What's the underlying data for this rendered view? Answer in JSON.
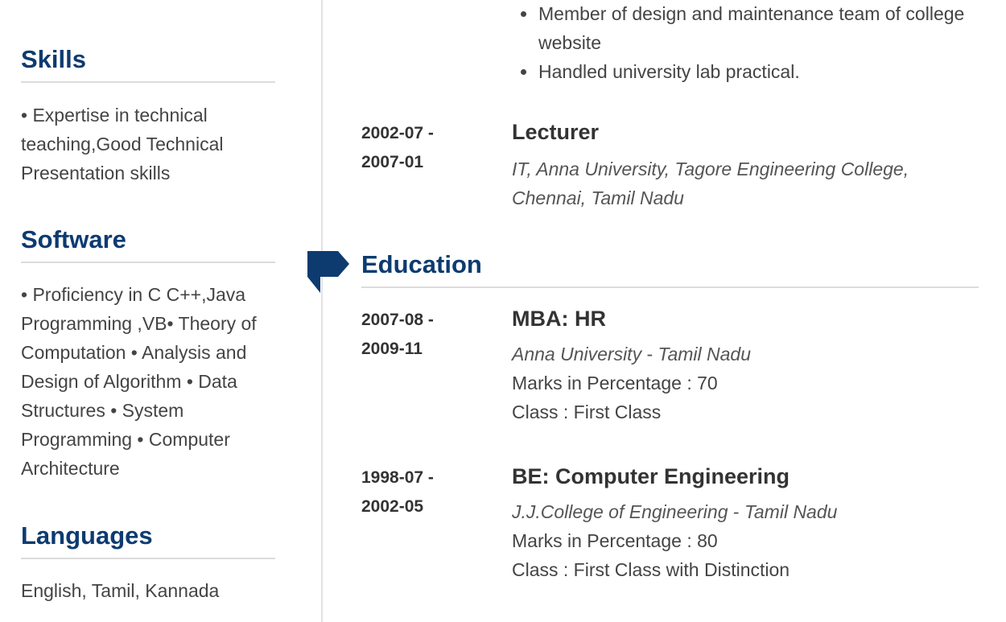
{
  "left": {
    "skills": {
      "heading": "Skills",
      "text": "• Expertise in technical teaching,Good Technical Presentation skills"
    },
    "software": {
      "heading": "Software",
      "text": "• Proficiency in C C++,Java Programming ,VB• Theory of Computation • Analysis and Design of Algorithm • Data Structures • System Programming • Computer Architecture"
    },
    "languages": {
      "heading": "Languages",
      "text": "English, Tamil, Kannada"
    }
  },
  "experience": {
    "bullets": [
      "Member of design and maintenance team of college website",
      "Handled university lab practical."
    ],
    "entry": {
      "date_start": "2002-07 -",
      "date_end": "2007-01",
      "title": "Lecturer",
      "subtitle": "IT, Anna University, Tagore Engineering College, Chennai, Tamil Nadu"
    }
  },
  "education": {
    "heading": "Education",
    "entries": [
      {
        "date_start": "2007-08 -",
        "date_end": "2009-11",
        "title": "MBA: HR",
        "institution": "Anna University",
        "separator": " - ",
        "location": "Tamil Nadu",
        "marks": "Marks in Percentage : 70",
        "class": "Class : First Class"
      },
      {
        "date_start": "1998-07 -",
        "date_end": "2002-05",
        "title": "BE: Computer Engineering",
        "institution": "J.J.College of Engineering",
        "separator": " - ",
        "location": "Tamil Nadu",
        "marks": "Marks in Percentage : 80",
        "class": "Class : First Class with Distinction"
      }
    ]
  },
  "colors": {
    "heading": "#0d3b70",
    "flag": "#0d3b70",
    "rule": "#dcdcdc",
    "text": "#444444"
  }
}
